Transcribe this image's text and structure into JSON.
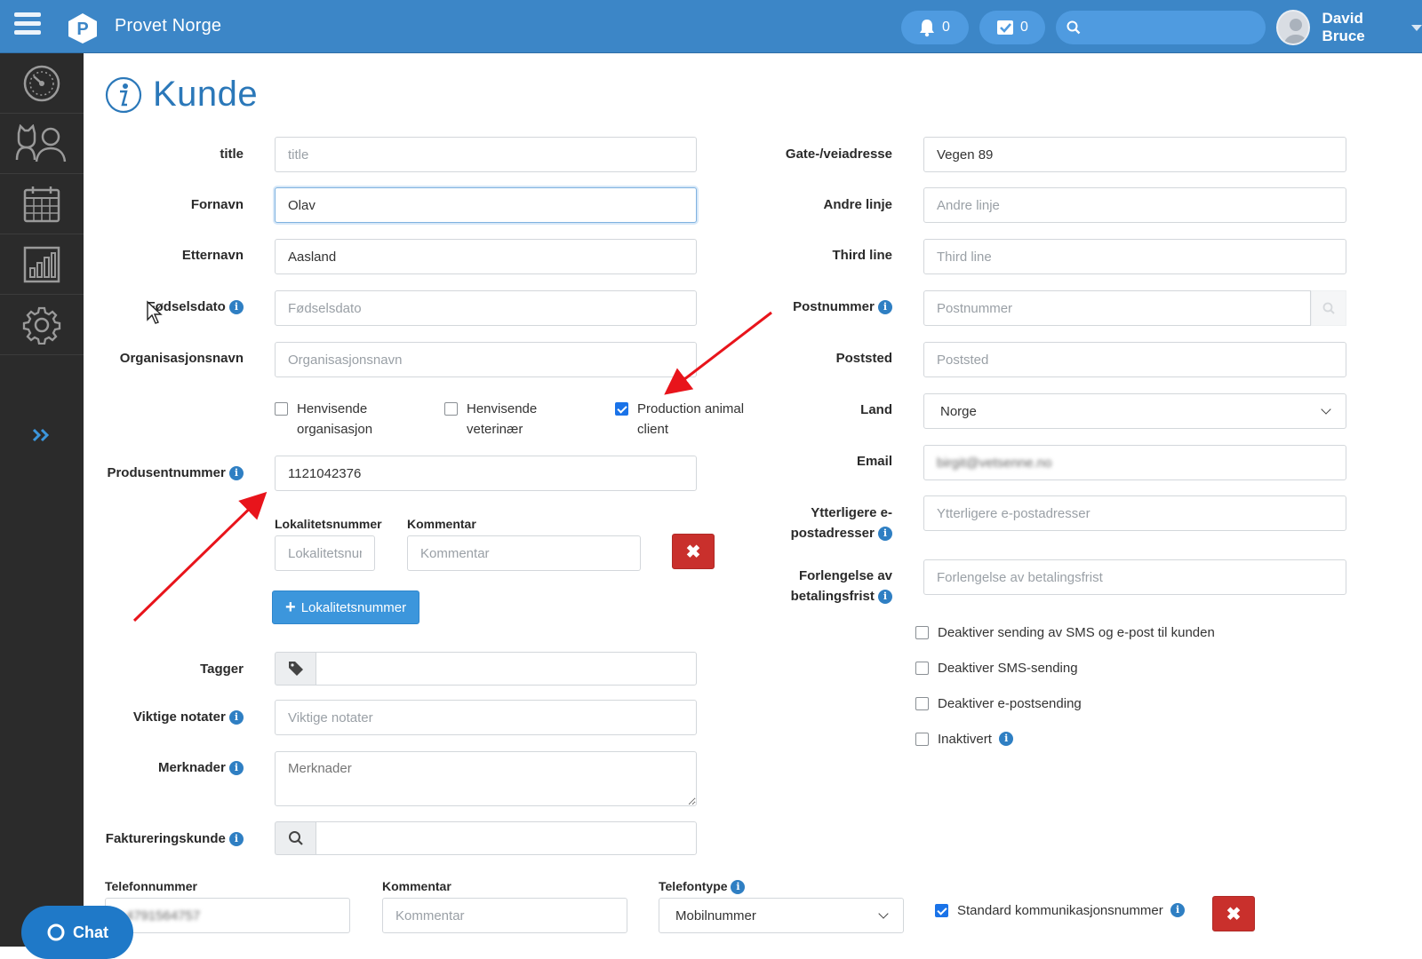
{
  "app": {
    "brand": "Provet Norge",
    "notifications_count": "0",
    "tasks_count": "0",
    "user_name": "David Bruce"
  },
  "page": {
    "title": "Kunde"
  },
  "form_left": {
    "title": {
      "label": "title",
      "placeholder": "title",
      "value": ""
    },
    "fornavn": {
      "label": "Fornavn",
      "value": "Olav"
    },
    "etternavn": {
      "label": "Etternavn",
      "value": "Aasland"
    },
    "fodselsdato": {
      "label": "Fødselsdato",
      "placeholder": "Fødselsdato"
    },
    "organisasjonsnavn": {
      "label": "Organisasjonsnavn",
      "placeholder": "Organisasjonsnavn"
    },
    "checkboxes": [
      {
        "line1": "Henvisende",
        "line2": "organisasjon",
        "checked": false
      },
      {
        "line1": "Henvisende",
        "line2": "veterinær",
        "checked": false
      },
      {
        "line1": "Production animal",
        "line2": "client",
        "checked": true
      }
    ],
    "produsentnummer": {
      "label": "Produsentnummer",
      "value": "1121042376"
    },
    "lokalitet": {
      "label": "Lokalitetsnummer",
      "placeholder": "Lokalitetsnummer",
      "comment_label": "Kommentar",
      "comment_placeholder": "Kommentar",
      "add_button": "Lokalitetsnummer"
    },
    "tagger": {
      "label": "Tagger"
    },
    "viktige_notater": {
      "label": "Viktige notater",
      "placeholder": "Viktige notater"
    },
    "merknader": {
      "label": "Merknader",
      "placeholder": "Merknader"
    },
    "faktureringskunde": {
      "label": "Faktureringskunde"
    }
  },
  "form_right": {
    "gate": {
      "label": "Gate-/veiadresse",
      "value": "Vegen 89"
    },
    "andre_linje": {
      "label": "Andre linje",
      "placeholder": "Andre linje"
    },
    "third_line": {
      "label": "Third line",
      "placeholder": "Third line"
    },
    "postnummer": {
      "label": "Postnummer",
      "placeholder": "Postnummer"
    },
    "poststed": {
      "label": "Poststed",
      "placeholder": "Poststed"
    },
    "land": {
      "label": "Land",
      "value": "Norge"
    },
    "email": {
      "label": "Email",
      "value": "birgit@vetsenne.no"
    },
    "ytterligere": {
      "label_line1": "Ytterligere e-",
      "label_line2": "postadresser",
      "placeholder": "Ytterligere e-postadresser"
    },
    "forlengelse": {
      "label_line1": "Forlengelse av",
      "label_line2": "betalingsfrist",
      "placeholder": "Forlengelse av betalingsfrist"
    },
    "options": [
      {
        "label": "Deaktiver sending av SMS og e-post til kunden",
        "checked": false
      },
      {
        "label": "Deaktiver SMS-sending",
        "checked": false
      },
      {
        "label": "Deaktiver e-postsending",
        "checked": false
      },
      {
        "label": "Inaktivert",
        "checked": false
      }
    ]
  },
  "phone": {
    "telefonnummer_label": "Telefonnummer",
    "telefonnummer_value": "+4791564757",
    "kommentar_label": "Kommentar",
    "kommentar_placeholder": "Kommentar",
    "telefontype_label": "Telefontype",
    "telefontype_value": "Mobilnummer",
    "standard_label": "Standard kommunikasjonsnummer",
    "standard_checked": true
  },
  "chat": {
    "label": "Chat"
  },
  "colors": {
    "topbar": "#3c86c7",
    "sidebar": "#2b2b2b",
    "accent": "#2b78b9",
    "danger": "#c9302c",
    "primary_button": "#3c96dc",
    "annotation_arrow": "#e8141b"
  }
}
